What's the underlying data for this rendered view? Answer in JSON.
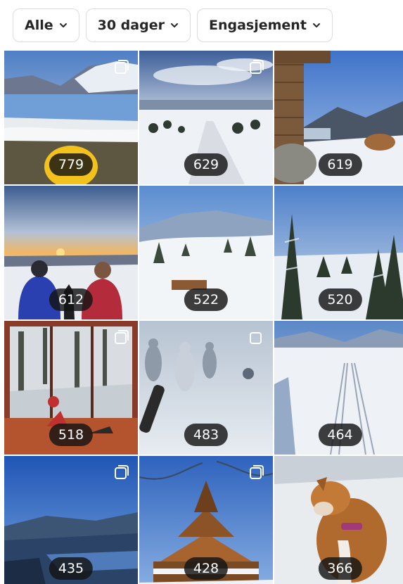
{
  "filters": [
    {
      "label": "Alle"
    },
    {
      "label": "30 dager"
    },
    {
      "label": "Engasjement"
    }
  ],
  "tiles": [
    {
      "count": "779",
      "multi": true,
      "scene": "lake-mountain-dog"
    },
    {
      "count": "629",
      "multi": true,
      "scene": "snowy-road-valley"
    },
    {
      "count": "619",
      "multi": false,
      "scene": "log-cabin-mountains"
    },
    {
      "count": "612",
      "multi": false,
      "scene": "sunset-couple-dog"
    },
    {
      "count": "522",
      "multi": false,
      "scene": "snowy-hills-cabin"
    },
    {
      "count": "520",
      "multi": false,
      "scene": "snowy-forest-trees"
    },
    {
      "count": "518",
      "multi": true,
      "scene": "cabin-window-interior"
    },
    {
      "count": "483",
      "multi": true,
      "scene": "skiers-blizzard"
    },
    {
      "count": "464",
      "multi": false,
      "scene": "ski-tracks-plain"
    },
    {
      "count": "435",
      "multi": true,
      "scene": "blue-fjord-view"
    },
    {
      "count": "428",
      "multi": true,
      "scene": "stave-church"
    },
    {
      "count": "366",
      "multi": false,
      "scene": "dog-in-snow"
    }
  ]
}
